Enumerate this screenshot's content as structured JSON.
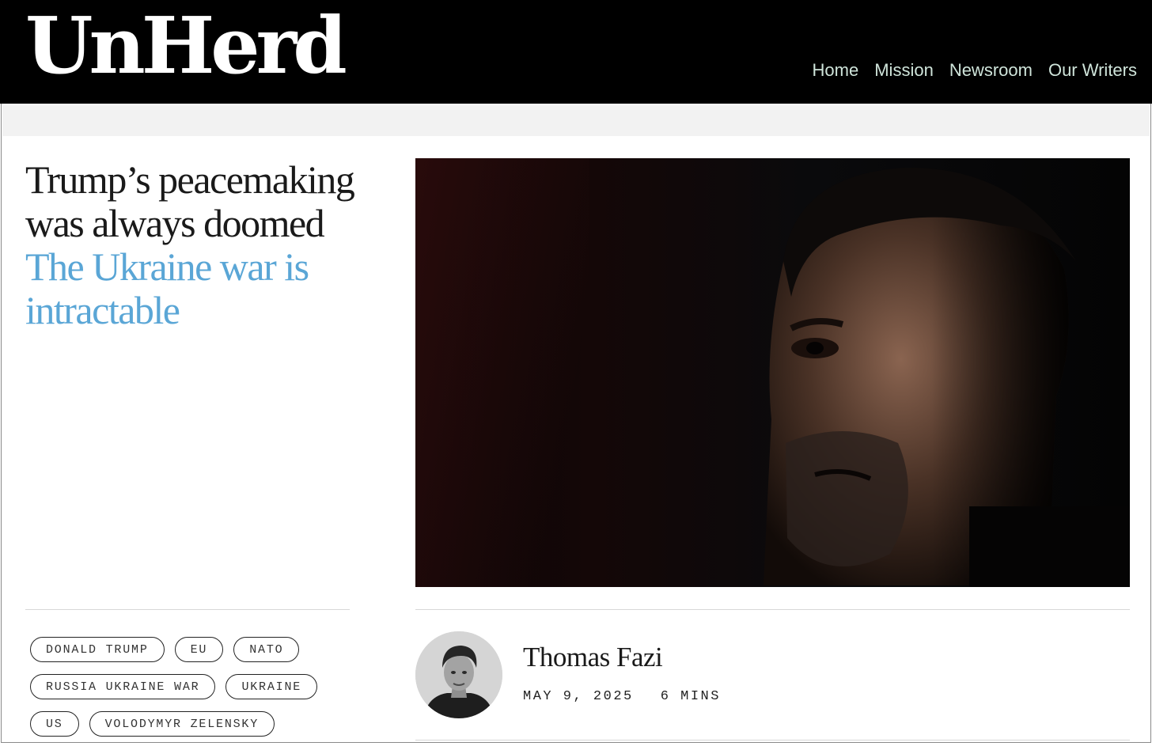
{
  "site": {
    "logo": "UnHerd"
  },
  "nav": {
    "items": [
      {
        "label": "Home"
      },
      {
        "label": "Mission"
      },
      {
        "label": "Newsroom"
      },
      {
        "label": "Our Writers"
      }
    ]
  },
  "article": {
    "title": "Trump’s peacemaking was always doomed",
    "subtitle": "The Ukraine war is intractable",
    "hero_image_icon": "portrait-photo",
    "author": {
      "name": "Thomas Fazi",
      "avatar_icon": "author-avatar"
    },
    "date": "MAY 9, 2025",
    "read_time": "6 MINS",
    "tags": [
      [
        "DONALD TRUMP",
        "EU",
        "NATO"
      ],
      [
        "RUSSIA UKRAINE WAR",
        "UKRAINE"
      ],
      [
        "US",
        "VOLODYMYR ZELENSKY"
      ]
    ]
  },
  "colors": {
    "header_bg": "#000000",
    "nav_text": "#cfe4da",
    "subtitle_accent": "#5aa6d6",
    "band_bg": "#f2f2f2"
  }
}
